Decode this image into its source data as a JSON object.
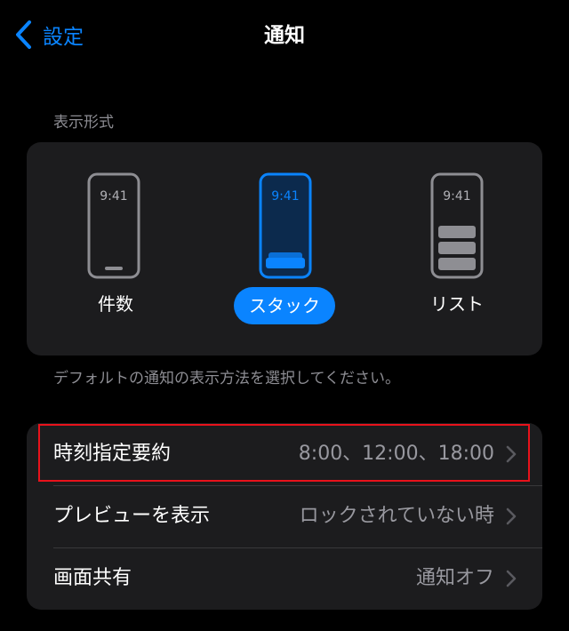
{
  "nav": {
    "back_label": "設定",
    "title": "通知"
  },
  "display_style": {
    "header": "表示形式",
    "options": [
      {
        "label": "件数",
        "time": "9:41",
        "selected": false
      },
      {
        "label": "スタック",
        "time": "9:41",
        "selected": true
      },
      {
        "label": "リスト",
        "time": "9:41",
        "selected": false
      }
    ],
    "footer": "デフォルトの通知の表示方法を選択してください。"
  },
  "settings": {
    "rows": [
      {
        "label": "時刻指定要約",
        "value": "8:00、12:00、18:00"
      },
      {
        "label": "プレビューを表示",
        "value": "ロックされていない時"
      },
      {
        "label": "画面共有",
        "value": "通知オフ"
      }
    ]
  },
  "colors": {
    "accent": "#0a84ff",
    "background": "#000000",
    "card": "#1c1c1e",
    "highlight": "#e8121b"
  },
  "icons": [
    "chevron-left-icon",
    "phone-count-icon",
    "phone-stack-icon",
    "phone-list-icon",
    "chevron-right-icon"
  ]
}
